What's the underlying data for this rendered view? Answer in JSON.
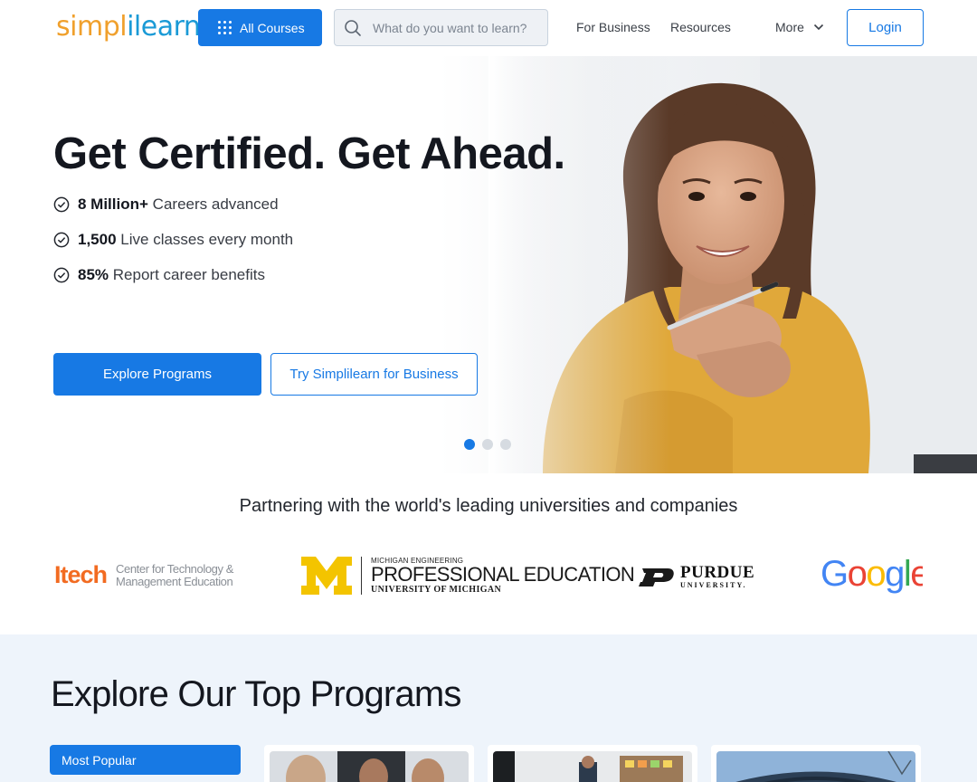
{
  "header": {
    "logo": {
      "part1": "simpl",
      "sep": "i",
      "part2": "learn"
    },
    "all_courses_label": "All Courses",
    "search_placeholder": "What do you want to learn?",
    "nav": {
      "business": "For Business",
      "resources": "Resources",
      "more": "More"
    },
    "login_label": "Login"
  },
  "hero": {
    "title": "Get Certified. Get Ahead.",
    "stats": [
      {
        "value": "8 Million+",
        "label": "Careers advanced"
      },
      {
        "value": "1,500",
        "label": "Live classes every month"
      },
      {
        "value": "85%",
        "label": "Report career benefits"
      }
    ],
    "primary_cta": "Explore Programs",
    "secondary_cta": "Try Simplilearn for Business",
    "carousel": {
      "slides": 3,
      "active": 1
    }
  },
  "partners": {
    "title": "Partnering with the world's leading universities and companies",
    "itech": {
      "mark": "Itech",
      "line1": "Center for Technology &",
      "line2": "Management Education"
    },
    "umich": {
      "line1": "MICHIGAN ENGINEERING",
      "line2": "PROFESSIONAL EDUCATION",
      "line3": "UNIVERSITY OF MICHIGAN"
    },
    "purdue": {
      "line1": "PURDUE",
      "line2": "UNIVERSITY."
    },
    "google": {
      "text": "Google"
    }
  },
  "programs": {
    "title": "Explore Our Top Programs",
    "active_tab": "Most Popular"
  },
  "colors": {
    "primary": "#1779e4",
    "logo_orange": "#f0a02c",
    "logo_blue": "#1a9ad6",
    "section_bg": "#eef4fb"
  }
}
